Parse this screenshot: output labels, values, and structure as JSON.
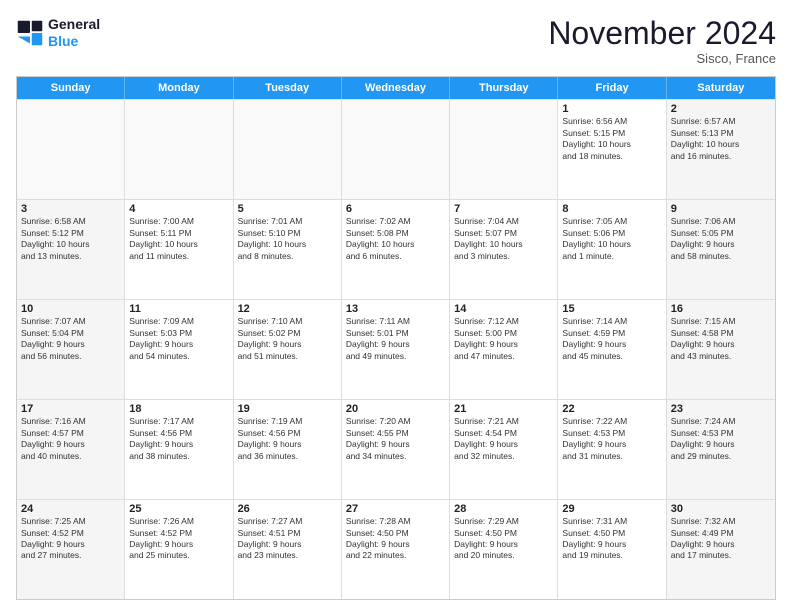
{
  "header": {
    "logo_line1": "General",
    "logo_line2": "Blue",
    "month_title": "November 2024",
    "location": "Sisco, France"
  },
  "weekdays": [
    "Sunday",
    "Monday",
    "Tuesday",
    "Wednesday",
    "Thursday",
    "Friday",
    "Saturday"
  ],
  "rows": [
    [
      {
        "day": "",
        "info": ""
      },
      {
        "day": "",
        "info": ""
      },
      {
        "day": "",
        "info": ""
      },
      {
        "day": "",
        "info": ""
      },
      {
        "day": "",
        "info": ""
      },
      {
        "day": "1",
        "info": "Sunrise: 6:56 AM\nSunset: 5:15 PM\nDaylight: 10 hours\nand 18 minutes."
      },
      {
        "day": "2",
        "info": "Sunrise: 6:57 AM\nSunset: 5:13 PM\nDaylight: 10 hours\nand 16 minutes."
      }
    ],
    [
      {
        "day": "3",
        "info": "Sunrise: 6:58 AM\nSunset: 5:12 PM\nDaylight: 10 hours\nand 13 minutes."
      },
      {
        "day": "4",
        "info": "Sunrise: 7:00 AM\nSunset: 5:11 PM\nDaylight: 10 hours\nand 11 minutes."
      },
      {
        "day": "5",
        "info": "Sunrise: 7:01 AM\nSunset: 5:10 PM\nDaylight: 10 hours\nand 8 minutes."
      },
      {
        "day": "6",
        "info": "Sunrise: 7:02 AM\nSunset: 5:08 PM\nDaylight: 10 hours\nand 6 minutes."
      },
      {
        "day": "7",
        "info": "Sunrise: 7:04 AM\nSunset: 5:07 PM\nDaylight: 10 hours\nand 3 minutes."
      },
      {
        "day": "8",
        "info": "Sunrise: 7:05 AM\nSunset: 5:06 PM\nDaylight: 10 hours\nand 1 minute."
      },
      {
        "day": "9",
        "info": "Sunrise: 7:06 AM\nSunset: 5:05 PM\nDaylight: 9 hours\nand 58 minutes."
      }
    ],
    [
      {
        "day": "10",
        "info": "Sunrise: 7:07 AM\nSunset: 5:04 PM\nDaylight: 9 hours\nand 56 minutes."
      },
      {
        "day": "11",
        "info": "Sunrise: 7:09 AM\nSunset: 5:03 PM\nDaylight: 9 hours\nand 54 minutes."
      },
      {
        "day": "12",
        "info": "Sunrise: 7:10 AM\nSunset: 5:02 PM\nDaylight: 9 hours\nand 51 minutes."
      },
      {
        "day": "13",
        "info": "Sunrise: 7:11 AM\nSunset: 5:01 PM\nDaylight: 9 hours\nand 49 minutes."
      },
      {
        "day": "14",
        "info": "Sunrise: 7:12 AM\nSunset: 5:00 PM\nDaylight: 9 hours\nand 47 minutes."
      },
      {
        "day": "15",
        "info": "Sunrise: 7:14 AM\nSunset: 4:59 PM\nDaylight: 9 hours\nand 45 minutes."
      },
      {
        "day": "16",
        "info": "Sunrise: 7:15 AM\nSunset: 4:58 PM\nDaylight: 9 hours\nand 43 minutes."
      }
    ],
    [
      {
        "day": "17",
        "info": "Sunrise: 7:16 AM\nSunset: 4:57 PM\nDaylight: 9 hours\nand 40 minutes."
      },
      {
        "day": "18",
        "info": "Sunrise: 7:17 AM\nSunset: 4:56 PM\nDaylight: 9 hours\nand 38 minutes."
      },
      {
        "day": "19",
        "info": "Sunrise: 7:19 AM\nSunset: 4:56 PM\nDaylight: 9 hours\nand 36 minutes."
      },
      {
        "day": "20",
        "info": "Sunrise: 7:20 AM\nSunset: 4:55 PM\nDaylight: 9 hours\nand 34 minutes."
      },
      {
        "day": "21",
        "info": "Sunrise: 7:21 AM\nSunset: 4:54 PM\nDaylight: 9 hours\nand 32 minutes."
      },
      {
        "day": "22",
        "info": "Sunrise: 7:22 AM\nSunset: 4:53 PM\nDaylight: 9 hours\nand 31 minutes."
      },
      {
        "day": "23",
        "info": "Sunrise: 7:24 AM\nSunset: 4:53 PM\nDaylight: 9 hours\nand 29 minutes."
      }
    ],
    [
      {
        "day": "24",
        "info": "Sunrise: 7:25 AM\nSunset: 4:52 PM\nDaylight: 9 hours\nand 27 minutes."
      },
      {
        "day": "25",
        "info": "Sunrise: 7:26 AM\nSunset: 4:52 PM\nDaylight: 9 hours\nand 25 minutes."
      },
      {
        "day": "26",
        "info": "Sunrise: 7:27 AM\nSunset: 4:51 PM\nDaylight: 9 hours\nand 23 minutes."
      },
      {
        "day": "27",
        "info": "Sunrise: 7:28 AM\nSunset: 4:50 PM\nDaylight: 9 hours\nand 22 minutes."
      },
      {
        "day": "28",
        "info": "Sunrise: 7:29 AM\nSunset: 4:50 PM\nDaylight: 9 hours\nand 20 minutes."
      },
      {
        "day": "29",
        "info": "Sunrise: 7:31 AM\nSunset: 4:50 PM\nDaylight: 9 hours\nand 19 minutes."
      },
      {
        "day": "30",
        "info": "Sunrise: 7:32 AM\nSunset: 4:49 PM\nDaylight: 9 hours\nand 17 minutes."
      }
    ]
  ]
}
